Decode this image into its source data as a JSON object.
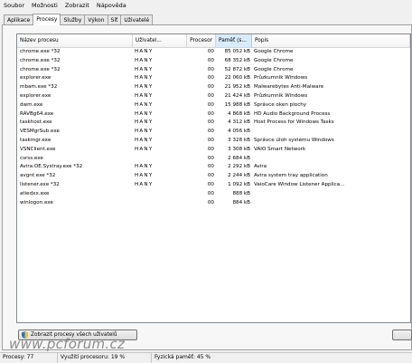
{
  "menu": [
    "Soubor",
    "Možnosti",
    "Zobrazit",
    "Nápověda"
  ],
  "tabs": [
    {
      "label": "Aplikace",
      "active": false
    },
    {
      "label": "Procesy",
      "active": true
    },
    {
      "label": "Služby",
      "active": false
    },
    {
      "label": "Výkon",
      "active": false
    },
    {
      "label": "Síť",
      "active": false
    },
    {
      "label": "Uživatelé",
      "active": false
    }
  ],
  "columns": {
    "name": "Název procesu",
    "user": "Uživatel...",
    "cpu": "Procesor",
    "mem": "Paměť (s...",
    "desc": "Popis"
  },
  "rows": [
    {
      "name": "chrome.exe *32",
      "user": "HANY",
      "cpu": "00",
      "mem": "85 052 kB",
      "desc": "Google Chrome"
    },
    {
      "name": "chrome.exe *32",
      "user": "HANY",
      "cpu": "00",
      "mem": "68 352 kB",
      "desc": "Google Chrome"
    },
    {
      "name": "chrome.exe *32",
      "user": "HANY",
      "cpu": "00",
      "mem": "52 872 kB",
      "desc": "Google Chrome"
    },
    {
      "name": "explorer.exe",
      "user": "HANY",
      "cpu": "00",
      "mem": "22 060 kB",
      "desc": "Průzkumník Windows"
    },
    {
      "name": "mbam.exe *32",
      "user": "HANY",
      "cpu": "00",
      "mem": "21 952 kB",
      "desc": "Malwarebytes Anti-Malware"
    },
    {
      "name": "explorer.exe",
      "user": "HANY",
      "cpu": "00",
      "mem": "21 424 kB",
      "desc": "Průzkumník Windows"
    },
    {
      "name": "dwm.exe",
      "user": "HANY",
      "cpu": "00",
      "mem": "15 988 kB",
      "desc": "Správce oken plochy"
    },
    {
      "name": "RAVBg64.exe",
      "user": "HANY",
      "cpu": "00",
      "mem": "4 868 kB",
      "desc": "HD Audio Background Process"
    },
    {
      "name": "taskhost.exe",
      "user": "HANY",
      "cpu": "00",
      "mem": "4 312 kB",
      "desc": "Host Process for Windows Tasks"
    },
    {
      "name": "VESMgrSub.exe",
      "user": "HANY",
      "cpu": "00",
      "mem": "4 056 kB",
      "desc": ""
    },
    {
      "name": "taskmgr.exe",
      "user": "HANY",
      "cpu": "00",
      "mem": "3 328 kB",
      "desc": "Správce úloh systému Windows"
    },
    {
      "name": "VSNClient.exe",
      "user": "HANY",
      "cpu": "00",
      "mem": "3 308 kB",
      "desc": "VAIO Smart Network"
    },
    {
      "name": "csrss.exe",
      "user": "",
      "cpu": "00",
      "mem": "2 684 kB",
      "desc": ""
    },
    {
      "name": "Avira.OE.Systray.exe *32",
      "user": "HANY",
      "cpu": "00",
      "mem": "2 292 kB",
      "desc": "Avira"
    },
    {
      "name": "avgnt.exe *32",
      "user": "HANY",
      "cpu": "00",
      "mem": "2 244 kB",
      "desc": "Avira system tray application"
    },
    {
      "name": "listener.exe *32",
      "user": "HANY",
      "cpu": "00",
      "mem": "1 092 kB",
      "desc": "VaioCare Window Listener Applica..."
    },
    {
      "name": "atiedxx.exe",
      "user": "",
      "cpu": "00",
      "mem": "888 kB",
      "desc": ""
    },
    {
      "name": "winlogon.exe",
      "user": "",
      "cpu": "00",
      "mem": "884 kB",
      "desc": ""
    }
  ],
  "buttons": {
    "show_all": "Zobrazit procesy všech uživatelů"
  },
  "watermark": "www.pcforum.cz",
  "status": {
    "processes": "Procesy: 77",
    "cpu": "Využití procesoru: 19 %",
    "memory": "Fyzická paměť: 45 %"
  }
}
